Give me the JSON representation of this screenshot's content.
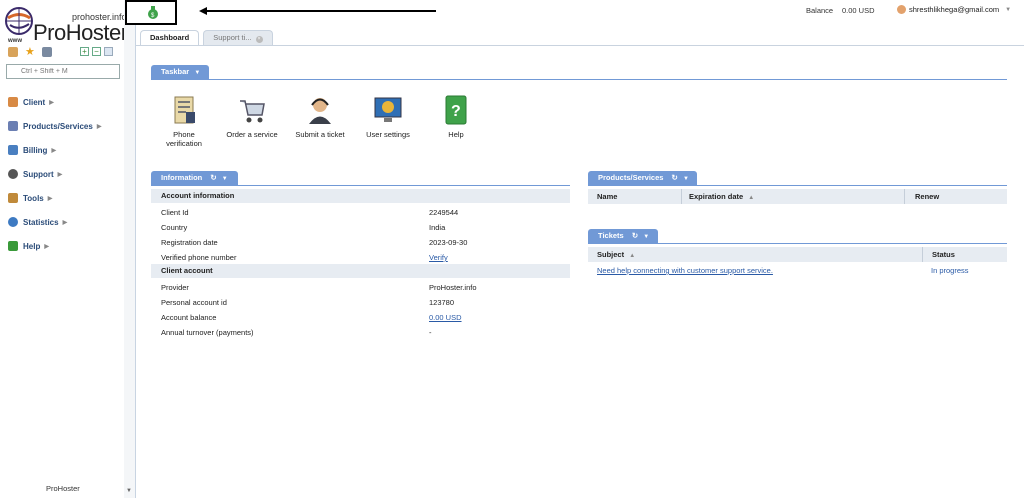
{
  "brand": {
    "small": "prohoster.info",
    "big": "ProHoster",
    "www": "www",
    "footer": "ProHoster"
  },
  "search": {
    "placeholder": "Ctrl + Shift + M"
  },
  "menu": [
    {
      "label": "Client",
      "color": "#d88a45"
    },
    {
      "label": "Products/Services",
      "color": "#6b7fb3"
    },
    {
      "label": "Billing",
      "color": "#4a7fc0"
    },
    {
      "label": "Support",
      "color": "#555"
    },
    {
      "label": "Tools",
      "color": "#c08a3a"
    },
    {
      "label": "Statistics",
      "color": "#3d7ac2"
    },
    {
      "label": "Help",
      "color": "#3a9a3a"
    }
  ],
  "topbar": {
    "balance_label": "Balance",
    "balance_value": "0.00 USD",
    "user": "shresthlikhega@gmail.com"
  },
  "tabs": [
    {
      "label": "Dashboard"
    },
    {
      "label": "Support ti..."
    }
  ],
  "taskbar": {
    "title": "Taskbar",
    "items": [
      {
        "line1": "Phone",
        "line2": "verification"
      },
      {
        "line1": "Order a service",
        "line2": ""
      },
      {
        "line1": "Submit a ticket",
        "line2": ""
      },
      {
        "line1": "User settings",
        "line2": ""
      },
      {
        "line1": "Help",
        "line2": ""
      }
    ]
  },
  "information": {
    "title": "Information",
    "section1": "Account information",
    "rows1": [
      {
        "k": "Client Id",
        "v": "2249544"
      },
      {
        "k": "Country",
        "v": "India"
      },
      {
        "k": "Registration date",
        "v": "2023-09-30"
      },
      {
        "k": "Verified phone number",
        "v": "Verify"
      }
    ],
    "section2": "Client account",
    "rows2": [
      {
        "k": "Provider",
        "v": "ProHoster.info"
      },
      {
        "k": "Personal account id",
        "v": "123780"
      },
      {
        "k": "Account balance",
        "v": "0.00 USD"
      },
      {
        "k": "Annual turnover (payments)",
        "v": "-"
      }
    ]
  },
  "products": {
    "title": "Products/Services",
    "cols": [
      "Name",
      "Expiration date",
      "Renew"
    ]
  },
  "tickets": {
    "title": "Tickets",
    "cols": [
      "Subject",
      "Status"
    ],
    "rows": [
      {
        "subject": "Need help connecting with customer support service.",
        "status": "In progress"
      }
    ]
  }
}
